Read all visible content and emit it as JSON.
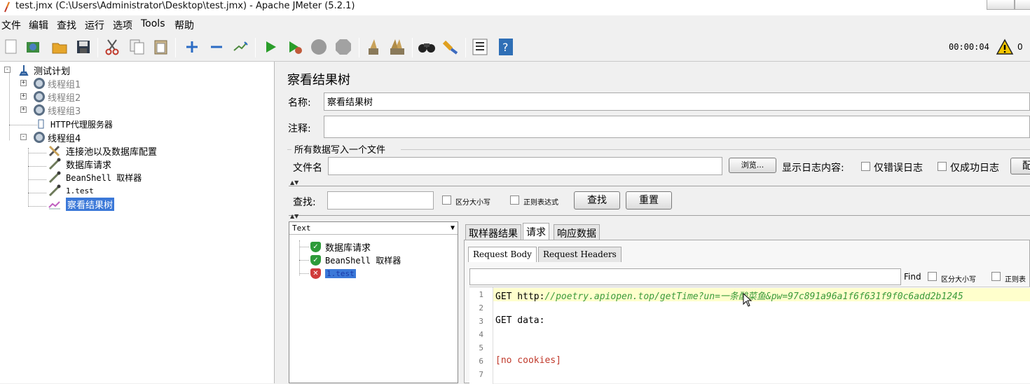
{
  "window": {
    "title": "test.jmx (C:\\Users\\Administrator\\Desktop\\test.jmx) - Apache JMeter (5.2.1)"
  },
  "menu": [
    "文件",
    "编辑",
    "查找",
    "运行",
    "选项",
    "Tools",
    "帮助"
  ],
  "toolbar": {
    "icons": [
      "new-icon",
      "templates-icon",
      "open-icon",
      "save-icon",
      "cut-icon",
      "copy-icon",
      "paste-icon",
      "expand-icon",
      "collapse-icon",
      "toggle-icon",
      "start-icon",
      "start-no-pause-icon",
      "stop-icon",
      "shutdown-icon",
      "clear-icon",
      "clear-all-icon",
      "search-icon",
      "reset-search-icon",
      "function-helper-icon",
      "help-icon"
    ],
    "timer": "00:00:04",
    "warning_count": "0",
    "accent": "#2a9d2a"
  },
  "tree": {
    "root": "测试计划",
    "groups": [
      "线程组1",
      "线程组2",
      "线程组3"
    ],
    "proxy": "HTTP代理服务器",
    "group4": "线程组4",
    "children": [
      "连接池以及数据库配置",
      "数据库请求",
      "BeanShell 取样器",
      "1.test",
      "察看结果树"
    ]
  },
  "panel": {
    "title": "察看结果树",
    "name_label": "名称:",
    "name_value": "察看结果树",
    "comment_label": "注释:",
    "comment_value": "",
    "file_section": "所有数据写入一个文件",
    "filename_label": "文件名",
    "filename_value": "",
    "browse_button": "浏览...",
    "log_label": "显示日志内容:",
    "errors_only": "仅错误日志",
    "success_only": "仅成功日志",
    "configure_button_partial": "配",
    "search_label": "查找:",
    "search_value": "",
    "case_sensitive": "区分大小写",
    "regex": "正则表达式",
    "search_button": "查找",
    "reset_button": "重置"
  },
  "results": {
    "renderer": "Text",
    "items": [
      {
        "label": "数据库请求",
        "status": "success"
      },
      {
        "label": "BeanShell 取样器",
        "status": "success"
      },
      {
        "label": "1.test",
        "status": "error"
      }
    ],
    "colors": {
      "success": "#2e9b3a",
      "error": "#d03a3a",
      "selection": "#3b78d8"
    }
  },
  "detail": {
    "tabs": [
      "取样器结果",
      "请求",
      "响应数据"
    ],
    "active_tab": "请求",
    "subtabs": [
      "Request Body",
      "Request Headers"
    ],
    "active_subtab": "Request Body",
    "find_label": "Find",
    "find_value": "",
    "case_label": "区分大小写",
    "regex_partial": "正则表",
    "lines": [
      {
        "num": "1",
        "prefix": "GET http:",
        "url": "//poetry.apiopen.top/getTime?un=一条酸菜鱼&pw=97c891a96a1f6f631f9f0c6add2b1245"
      },
      {
        "num": "2",
        "text": ""
      },
      {
        "num": "3",
        "text": "GET data:"
      },
      {
        "num": "4",
        "text": ""
      },
      {
        "num": "5",
        "text": ""
      },
      {
        "num": "6",
        "text": "[no cookies]"
      },
      {
        "num": "7",
        "text": ""
      }
    ]
  }
}
